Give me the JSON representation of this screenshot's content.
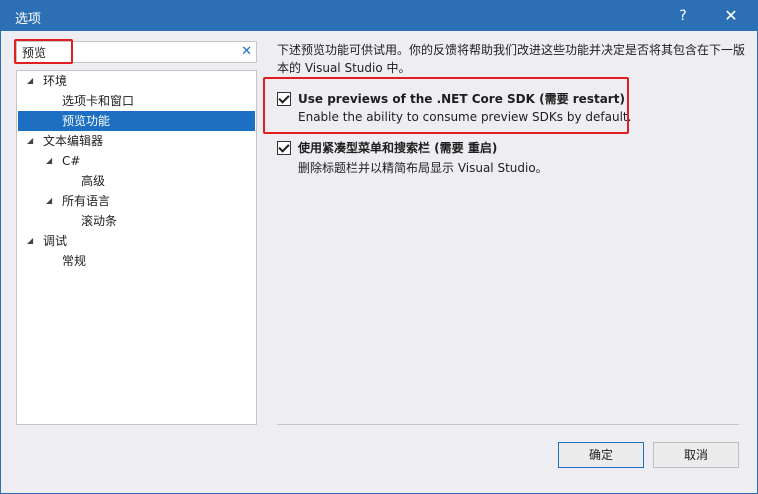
{
  "window": {
    "title": "选项",
    "help": "?",
    "close": "✕"
  },
  "search": {
    "value": "预览",
    "clear": "✕"
  },
  "tree": [
    {
      "label": "环境",
      "arrow": "◢"
    },
    {
      "label": "选项卡和窗口"
    },
    {
      "label": "预览功能",
      "selected": true
    },
    {
      "label": "文本编辑器",
      "arrow": "◢"
    },
    {
      "label": "C#",
      "arrow": "◢"
    },
    {
      "label": "高级"
    },
    {
      "label": "所有语言",
      "arrow": "◢"
    },
    {
      "label": "滚动条"
    },
    {
      "label": "调试",
      "arrow": "◢"
    },
    {
      "label": "常规"
    }
  ],
  "content": {
    "description": "下述预览功能可供试用。你的反馈将帮助我们改进这些功能并决定是否将其包含在下一版本的 Visual Studio 中。",
    "options": [
      {
        "title": "Use previews of the .NET Core SDK (需要 restart)",
        "desc": "Enable the ability to consume preview SDKs by default.",
        "checked": true
      },
      {
        "title": "使用紧凑型菜单和搜索栏 (需要 重启)",
        "desc": "删除标题栏并以精简布局显示 Visual Studio。",
        "checked": true
      }
    ]
  },
  "buttons": {
    "ok": "确定",
    "cancel": "取消"
  }
}
